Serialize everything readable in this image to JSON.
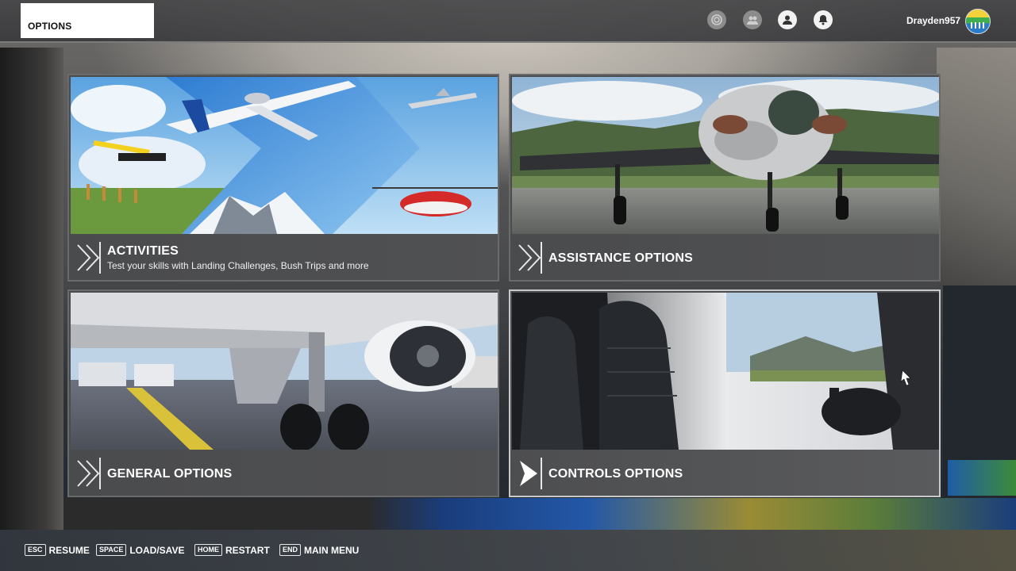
{
  "header": {
    "title": "OPTIONS",
    "username": "Drayden957",
    "icons": [
      "activity-icon",
      "friends-icon",
      "profile-icon",
      "notifications-icon"
    ]
  },
  "tiles": [
    {
      "id": "activities",
      "title": "ACTIVITIES",
      "subtitle": "Test your skills with Landing Challenges, Bush Trips and more",
      "selected": false
    },
    {
      "id": "assistance",
      "title": "ASSISTANCE OPTIONS",
      "selected": false
    },
    {
      "id": "general",
      "title": "GENERAL OPTIONS",
      "selected": false
    },
    {
      "id": "controls",
      "title": "CONTROLS OPTIONS",
      "selected": true
    }
  ],
  "footer": {
    "hints": [
      {
        "key": "ESC",
        "label": "RESUME"
      },
      {
        "key": "SPACE",
        "label": "LOAD/SAVE"
      },
      {
        "key": "HOME",
        "label": "RESTART"
      },
      {
        "key": "END",
        "label": "MAIN MENU"
      }
    ]
  },
  "colors": {
    "selected_border": "#c9c9c9",
    "tile_bar": "#4a4b4d",
    "header_bg": "#ffffff"
  }
}
